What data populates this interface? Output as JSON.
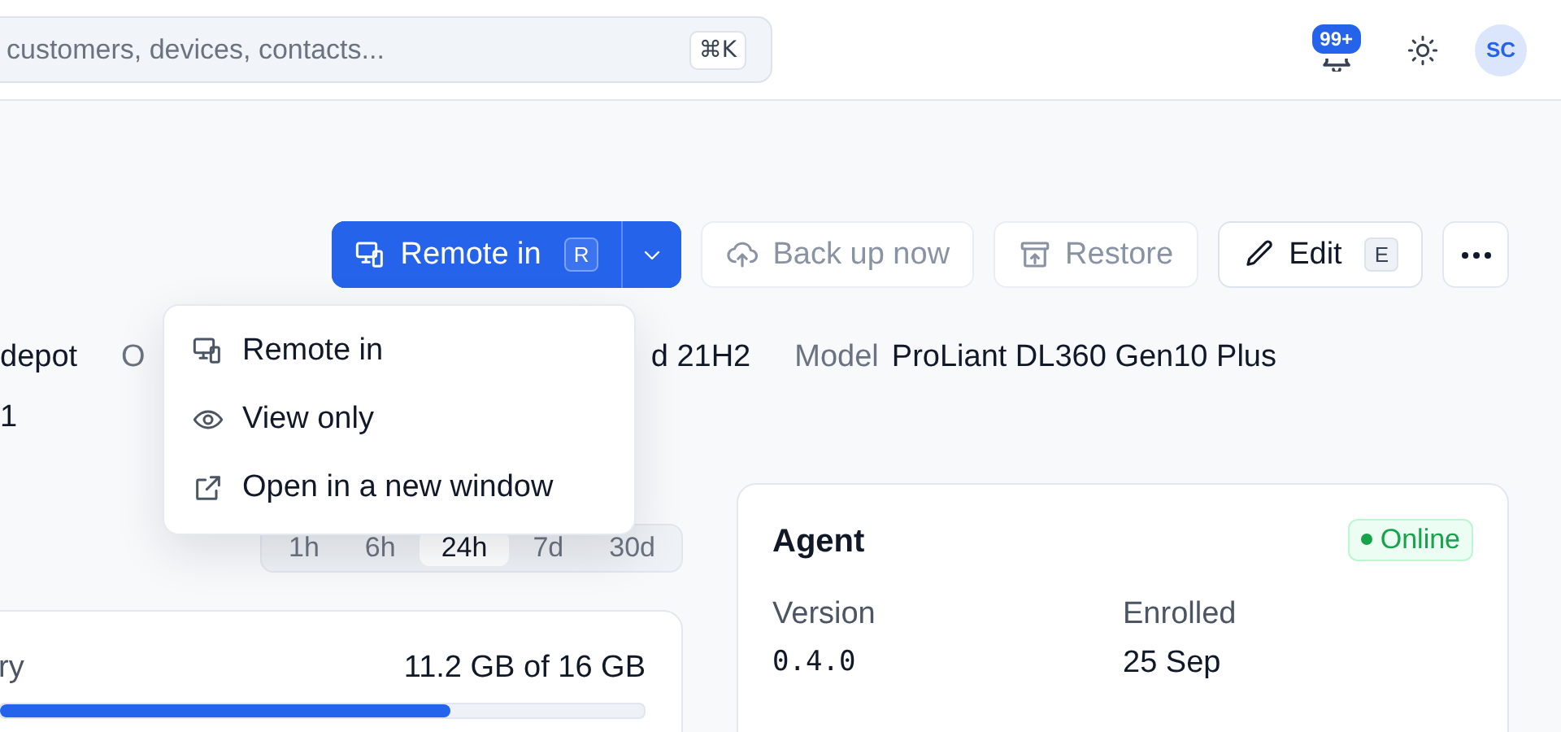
{
  "header": {
    "search": {
      "placeholder": "customers, devices, contacts...",
      "shortcut": "⌘K"
    },
    "notifications": {
      "badge": "99+"
    },
    "avatar": {
      "initials": "SC"
    }
  },
  "actions": [
    {
      "kind": "split",
      "label": "Remote in",
      "shortcut": "R",
      "expanded": true
    },
    {
      "kind": "backup",
      "label": "Back up now",
      "disabled": true
    },
    {
      "kind": "restore",
      "label": "Restore",
      "disabled": true
    },
    {
      "kind": "edit",
      "label": "Edit",
      "shortcut": "E",
      "disabled": false
    },
    {
      "kind": "more"
    }
  ],
  "menu": [
    {
      "kind": "remote",
      "label": "Remote in"
    },
    {
      "kind": "view",
      "label": "View only"
    },
    {
      "kind": "external",
      "label": "Open in a new window"
    }
  ],
  "details": {
    "row_1": [
      {
        "kind": "value",
        "text": "depot"
      },
      {
        "kind": "label",
        "text": "O"
      },
      {
        "kind": "value",
        "text": "d 21H2"
      },
      {
        "kind": "label",
        "text": "Model"
      },
      {
        "kind": "value",
        "text": "ProLiant DL360 Gen10 Plus"
      }
    ],
    "row_2": [
      {
        "kind": "value",
        "text": "1"
      }
    ]
  },
  "time_range": [
    {
      "label": "1h",
      "selected": false
    },
    {
      "label": "6h",
      "selected": false
    },
    {
      "label": "24h",
      "selected": true
    },
    {
      "label": "7d",
      "selected": false
    },
    {
      "label": "30d",
      "selected": false
    }
  ],
  "memory": {
    "label": "ry",
    "reading": "11.2 GB of 16 GB",
    "level": 0.7
  },
  "agent": {
    "title": "Agent",
    "status": {
      "label": "Online",
      "color": "#16a34a"
    },
    "fields": [
      {
        "label": "Version",
        "value": "0.4.0",
        "kind": "mono"
      },
      {
        "label": "Enrolled",
        "value": "25 Sep",
        "kind": "text"
      }
    ]
  }
}
